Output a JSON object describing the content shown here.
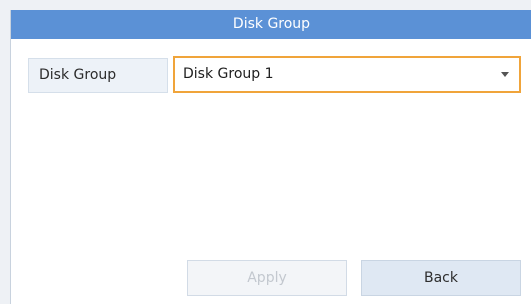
{
  "dialog": {
    "title": "Disk Group"
  },
  "form": {
    "field_label": "Disk Group",
    "selected_value": "Disk Group 1"
  },
  "buttons": {
    "apply_label": "Apply",
    "back_label": "Back"
  },
  "colors": {
    "title_bar": "#5b91d6",
    "select_focus_border": "#f0a43a"
  },
  "icons": {
    "dropdown": "caret-down-icon"
  }
}
